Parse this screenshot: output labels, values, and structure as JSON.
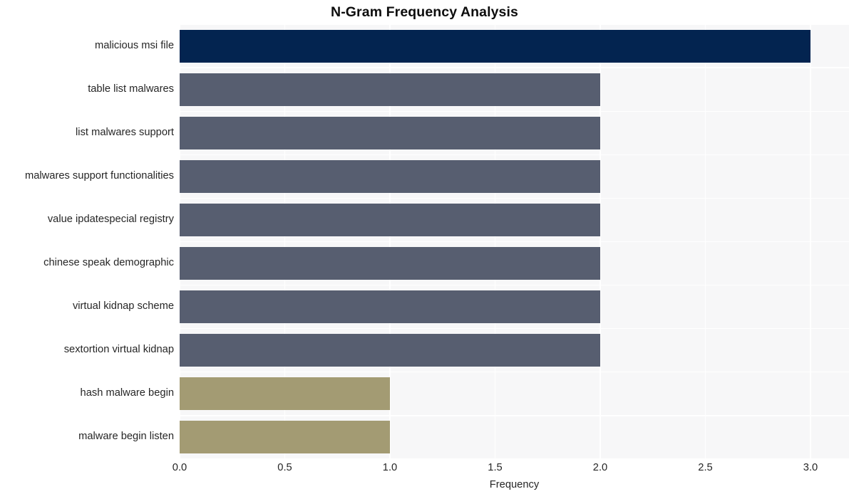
{
  "chart_data": {
    "type": "bar",
    "orientation": "horizontal",
    "title": "N-Gram Frequency Analysis",
    "xlabel": "Frequency",
    "ylabel": "",
    "xlim": [
      0.0,
      3.0
    ],
    "xticks": [
      "0.0",
      "0.5",
      "1.0",
      "1.5",
      "2.0",
      "2.5",
      "3.0"
    ],
    "xtick_values": [
      0.0,
      0.5,
      1.0,
      1.5,
      2.0,
      2.5,
      3.0
    ],
    "grid": true,
    "legend": "none",
    "categories": [
      "malicious msi file",
      "table list malwares",
      "list malwares support",
      "malwares support functionalities",
      "value ipdatespecial registry",
      "chinese speak demographic",
      "virtual kidnap scheme",
      "sextortion virtual kidnap",
      "hash malware begin",
      "malware begin listen"
    ],
    "values": [
      3,
      2,
      2,
      2,
      2,
      2,
      2,
      2,
      1,
      1
    ],
    "bar_colors": [
      "#032450",
      "#575e70",
      "#575e70",
      "#575e70",
      "#575e70",
      "#575e70",
      "#575e70",
      "#575e70",
      "#a39b73",
      "#a39b73"
    ]
  },
  "style": {
    "plot_background": "#f7f7f8",
    "figure_background": "#ffffff",
    "gridline_color": "#ffffff",
    "text_color": "#262626",
    "title_color": "#0d0d0d"
  }
}
